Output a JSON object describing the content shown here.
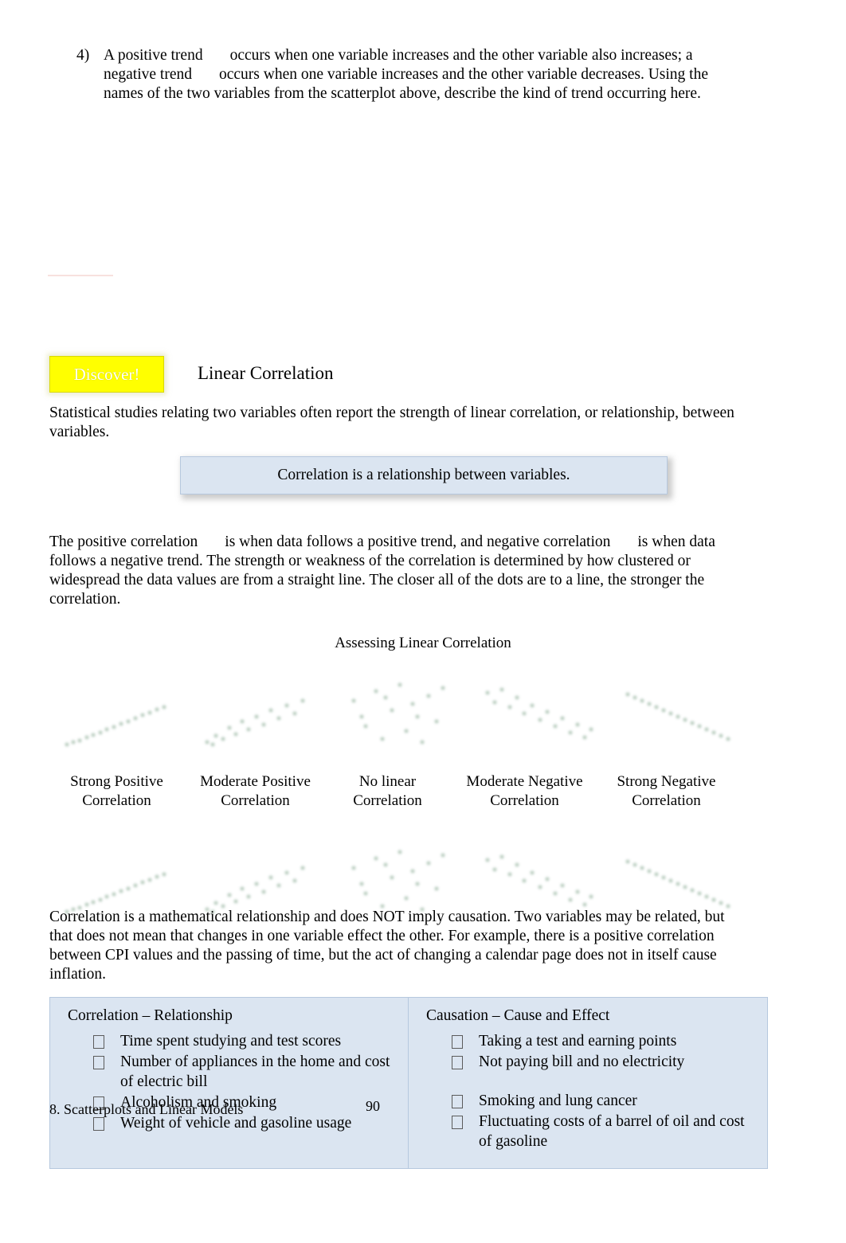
{
  "question": {
    "number": "4)",
    "text_part1": "A  positive trend",
    "text_part2": "occurs when one variable increases and the other variable also increases; a negative trend",
    "text_part3": "occurs when one variable increases and the other variable decreases. Using the names of the two variables from the scatterplot above, describe the kind of trend occurring here."
  },
  "discover": {
    "badge_label": "Discover!",
    "section_title": "Linear Correlation"
  },
  "intro_paragraph": "Statistical studies relating two variables often report the strength of linear correlation, or relationship, between variables.",
  "callout": {
    "definition": "Correlation  is a relationship between variables."
  },
  "positive_paragraph": {
    "part1": "The positive correlation",
    "part2": "is when data follows a positive trend, and negative correlation",
    "part3": "is when data follows a negative trend.  The strength or weakness of the correlation is determined by how clustered or widespread the data values are from a straight line.  The closer all of the dots are to a line, the stronger the correlation."
  },
  "figure": {
    "title": "Assessing Linear Correlation",
    "plots": [
      {
        "label_line1": "Strong Positive",
        "label_line2": "Correlation",
        "kind": "strong-positive"
      },
      {
        "label_line1": "Moderate Positive",
        "label_line2": "Correlation",
        "kind": "moderate-positive"
      },
      {
        "label_line1": "No linear",
        "label_line2": "Correlation",
        "kind": "none"
      },
      {
        "label_line1": "Moderate Negative",
        "label_line2": "Correlation",
        "kind": "moderate-negative"
      },
      {
        "label_line1": "Strong Negative",
        "label_line2": "Correlation",
        "kind": "strong-negative"
      }
    ]
  },
  "causation_paragraph": "Correlation is a mathematical relationship and does NOT  imply causation.  Two variables may be related, but that does not mean that changes in one variable effect the other.  For example, there is a positive correlation between CPI values and the passing of time, but the act of changing a calendar page does not in itself cause inflation.",
  "table": {
    "left": {
      "header": "Correlation – Relationship",
      "items": [
        "Time spent studying and test scores",
        "Number of appliances in the home and cost of electric bill",
        "Alcoholism and smoking",
        "Weight of vehicle and gasoline usage"
      ]
    },
    "right": {
      "header": "Causation – Cause and Effect",
      "items": [
        "Taking a test and earning points",
        "Not paying bill and no electricity",
        "Smoking and lung cancer",
        "Fluctuating costs of a barrel of oil and cost of gasoline"
      ]
    }
  },
  "footer": {
    "section_label": "8. Scatterplots and Linear Models",
    "page_number": "90"
  },
  "colors": {
    "callout_fill": "#dbe5f1",
    "callout_border": "#b6c8de",
    "highlight": "#ffff00",
    "rule": "#f2c9c2"
  }
}
